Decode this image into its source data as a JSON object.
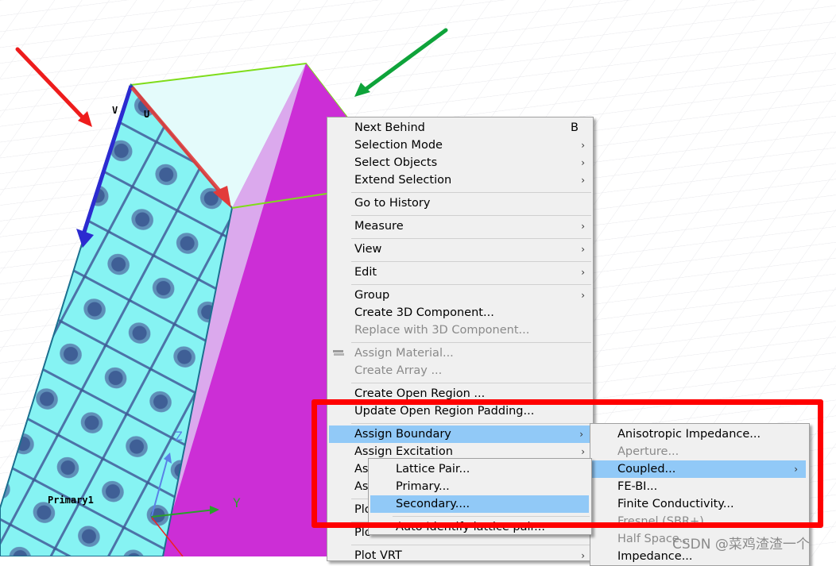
{
  "viewport": {
    "labels": {
      "v_axis": "V",
      "u_axis": "U",
      "face_label": "Primary1",
      "z_axis": "Z",
      "y_axis": "Y"
    },
    "colors": {
      "background": "#ffffff",
      "grid": "#e6e6ea",
      "face_pattern": "#86f3f3",
      "face_dots": "#3f5f96",
      "side_face": "#cc2ed6",
      "top_face": "#e4fbfb",
      "edge_highlight": "#7fdc1a",
      "u_vector": "#e23b3b",
      "v_vector": "#2b2bd0"
    },
    "annotations": {
      "red_arrow": "#ee1c1c",
      "green_arrow": "#0ea33a",
      "highlight_box": "#ff0000"
    }
  },
  "context_menu": {
    "items": [
      {
        "label": "Next Behind",
        "shortcut": "B"
      },
      {
        "label": "Selection Mode",
        "submenu": true
      },
      {
        "label": "Select Objects",
        "submenu": true
      },
      {
        "label": "Extend Selection",
        "submenu": true
      },
      {
        "label": "Go to History"
      },
      {
        "label": "Measure",
        "submenu": true
      },
      {
        "label": "View",
        "submenu": true
      },
      {
        "label": "Edit",
        "submenu": true
      },
      {
        "label": "Group",
        "submenu": true
      },
      {
        "label": "Create 3D Component..."
      },
      {
        "label": "Replace with 3D Component...",
        "disabled": true
      },
      {
        "label": "Assign Material...",
        "disabled": true,
        "icon": "material-icon"
      },
      {
        "label": "Create Array ...",
        "disabled": true
      },
      {
        "label": "Create Open Region ..."
      },
      {
        "label": "Update Open Region Padding..."
      },
      {
        "label": "Assign Boundary",
        "submenu": true,
        "highlighted": true
      },
      {
        "label": "Assign Excitation",
        "submenu": true
      },
      {
        "label": "As",
        "submenu": false
      },
      {
        "label": "As",
        "submenu": false
      },
      {
        "label": "Plo"
      },
      {
        "label": "Plo"
      },
      {
        "label": "Plot VRT",
        "submenu": true
      }
    ],
    "arrow_glyph": "›"
  },
  "boundary_submenu": {
    "items": [
      {
        "label": "Anisotropic Impedance..."
      },
      {
        "label": "Aperture...",
        "disabled": true
      },
      {
        "label": "Coupled...",
        "submenu": true,
        "highlighted": true
      },
      {
        "label": "FE-BI..."
      },
      {
        "label": "Finite Conductivity..."
      },
      {
        "label": "Fresnel (SBR+)",
        "disabled": true
      },
      {
        "label": "Half Space...",
        "disabled": true
      },
      {
        "label": "Impedance..."
      }
    ]
  },
  "coupled_submenu": {
    "items": [
      {
        "label": "Lattice Pair..."
      },
      {
        "label": "Primary..."
      },
      {
        "label": "Secondary....",
        "highlighted": true
      },
      {
        "label": "Auto Identify lattice pair..."
      }
    ]
  },
  "watermark": "CSDN @菜鸡渣渣一个"
}
